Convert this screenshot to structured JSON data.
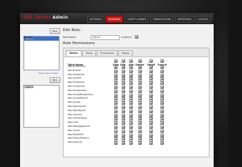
{
  "app": {
    "logo_main": "SQL Server",
    "logo_sub": "Admin"
  },
  "nav": [
    "SETTINGS",
    "DATABASE",
    "SCRIPT LIBRARY",
    "TRANSLATIONS",
    "REPORTING",
    "LOGOUT"
  ],
  "nav_active_index": 1,
  "roles": {
    "title": "Roles:",
    "new_label": "New",
    "items": [
      "Admin"
    ],
    "selected": "Admin",
    "link": "Show users in Role"
  },
  "users": {
    "title": "Users:",
    "new_label": "New",
    "items": [
      "admin"
    ]
  },
  "edit": {
    "heading": "Edit Role:",
    "role_name_label": "Role Name:",
    "role_name_value": "Admin",
    "is_admin_label": "Is Admin:",
    "is_admin_checked": true
  },
  "permissions": {
    "heading": "Role Permissions",
    "tabs": [
      "Tables",
      "Views",
      "Procedures",
      "Pages"
    ],
    "active_tab": "Tables",
    "columns": [
      "Table Name",
      "View",
      "Edit",
      "Add",
      "Delete",
      "Detail",
      "Search"
    ],
    "rows": [
      "dbo.ActiveUsers",
      "dbo.Articles",
      "dbo.Categories",
      "dbo.Content",
      "dbo.Exceptions",
      "dbo.GroupChat",
      "dbo.GroupInvites",
      "dbo.GroupMembership",
      "dbo.GroupObjects",
      "dbo.Groups",
      "dbo.IdpsConnect",
      "dbo.IdpsObjects",
      "dbo.Licenses",
      "dbo.LicenseTypes",
      "dbo.Links",
      "dbo.MessageRecord",
      "dbo.Orders",
      "dbo.PayPalIPN",
      "dbo.ProductMetrics",
      "dbo.Products"
    ]
  },
  "colors": {
    "accent": "#c81818",
    "selection": "#3a6fd0",
    "topbar": "#2a2a2a"
  }
}
